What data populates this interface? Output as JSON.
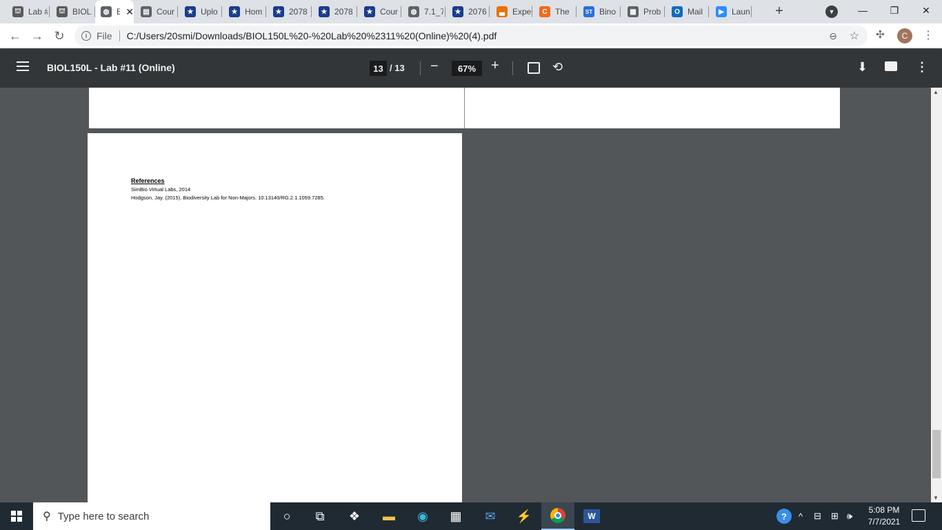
{
  "browser": {
    "tabs": [
      {
        "title": "Lab #",
        "icon": "ucla-icon",
        "color": "#5b5b5b"
      },
      {
        "title": "BIOL",
        "icon": "ucla-icon",
        "color": "#5b5b5b"
      },
      {
        "title": "B",
        "icon": "globe-icon",
        "color": "#5f6368",
        "active": true
      },
      {
        "title": "Cour",
        "icon": "document-icon",
        "color": "#5f6368"
      },
      {
        "title": "Uplo",
        "icon": "star-badge-icon",
        "color": "#1a3c8f"
      },
      {
        "title": "Hom",
        "icon": "star-badge-icon",
        "color": "#1a3c8f"
      },
      {
        "title": "2078",
        "icon": "star-badge-icon",
        "color": "#1a3c8f"
      },
      {
        "title": "2078",
        "icon": "star-badge-icon",
        "color": "#1a3c8f"
      },
      {
        "title": "Cour",
        "icon": "star-badge-icon",
        "color": "#1a3c8f"
      },
      {
        "title": "7.1_7",
        "icon": "globe-icon",
        "color": "#5f6368"
      },
      {
        "title": "2076",
        "icon": "star-badge-icon",
        "color": "#1a3c8f"
      },
      {
        "title": "Expe",
        "icon": "bar-chart-icon",
        "color": "#e8710a"
      },
      {
        "title": "The",
        "icon": "c-logo-icon",
        "color": "#f06a1d"
      },
      {
        "title": "Bino",
        "icon": "st-logo-icon",
        "color": "#2a6fdb"
      },
      {
        "title": "Prob",
        "icon": "calculator-icon",
        "color": "#5f6368"
      },
      {
        "title": "Mail",
        "icon": "outlook-icon",
        "color": "#0f6cbd"
      },
      {
        "title": "Laun",
        "icon": "zoom-icon",
        "color": "#2d8cff"
      }
    ],
    "url_scheme_label": "File",
    "url": "C:/Users/20smi/Downloads/BIOL150L%20-%20Lab%20%2311%20(Online)%20(4).pdf",
    "profile_initial": "C"
  },
  "pdf_toolbar": {
    "title": "BIOL150L - Lab #11 (Online)",
    "current_page": "13",
    "total_pages": "/ 13",
    "zoom": "67%"
  },
  "document": {
    "references_heading": "References",
    "references": [
      "SimBio Virtual Labs, 2014",
      "Hodgson, Jay. (2015). Biodiversity Lab for Non-Majors. 10.13140/RG.2.1.1059.7285."
    ]
  },
  "taskbar": {
    "search_placeholder": "Type here to search",
    "time": "5:08 PM",
    "date": "7/7/2021",
    "apps": [
      "cortana-icon",
      "task-view-icon",
      "dropbox-icon",
      "file-explorer-icon",
      "edge-icon",
      "store-icon",
      "mail-icon",
      "app-icon",
      "chrome-icon",
      "word-icon"
    ]
  },
  "colors": {
    "pdf_toolbar_bg": "#323639",
    "viewer_bg": "#525659",
    "taskbar_bg": "#1f2a33"
  }
}
